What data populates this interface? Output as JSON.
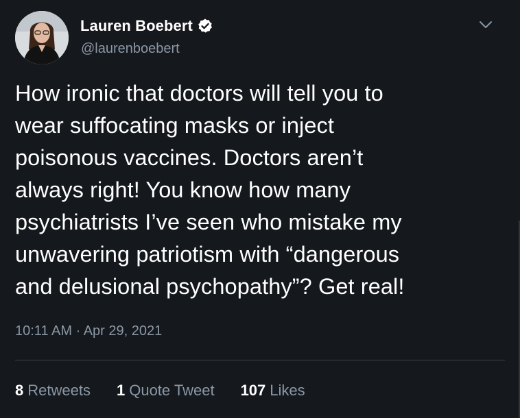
{
  "author": {
    "display_name": "Lauren Boebert",
    "handle": "@laurenboebert",
    "verified": true
  },
  "icons": {
    "verified": "verified-badge-icon",
    "menu": "chevron-down-icon"
  },
  "tweet": {
    "text": "How ironic that doctors will tell you to\nwear suffocating masks or inject\npoisonous vaccines. Doctors aren’t\nalways right! You know how many\npsychiatrists I’ve seen who mistake my\nunwavering patriotism with “dangerous\nand delusional psychopathy”? Get real!",
    "timestamp": "10:11 AM · Apr 29, 2021"
  },
  "stats": {
    "retweets": {
      "count": "8",
      "label": "Retweets"
    },
    "quotes": {
      "count": "1",
      "label": "Quote Tweet"
    },
    "likes": {
      "count": "107",
      "label": "Likes"
    }
  },
  "colors": {
    "background": "#15181d",
    "text_primary": "#ffffff",
    "text_secondary": "#8b98a5",
    "divider": "#38444d"
  }
}
